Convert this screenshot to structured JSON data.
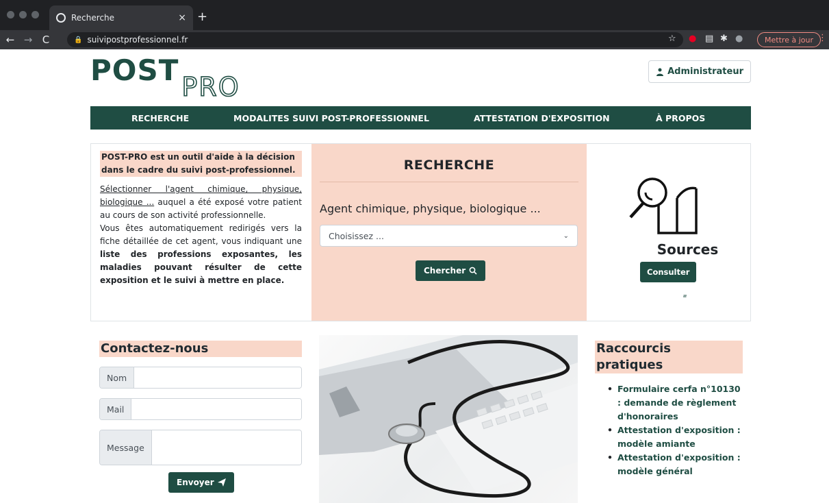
{
  "browser": {
    "tab_title": "Recherche",
    "tab_close": "×",
    "new_tab": "+",
    "url": "suivipostprofessionnel.fr",
    "update_button": "Mettre à jour"
  },
  "header": {
    "logo_post": "POST",
    "logo_pro": "PRO",
    "admin_label": "Administrateur"
  },
  "nav": {
    "items": [
      "RECHERCHE",
      "MODALITES SUIVI POST-PROFESSIONNEL",
      "ATTESTATION D'EXPOSITION",
      "À PROPOS"
    ]
  },
  "intro": {
    "highlight": "POST-PRO est un outil d'aide à la décision dans le cadre du suivi post-professionnel.",
    "select_link": "Sélectionner l'agent chimique, physique, biologique ...",
    "select_rest": " auquel a été exposé votre patient au cours de son activité professionnelle.",
    "redirect_text": "Vous êtes automatiquement redirigés vers la fiche détaillée de cet agent, vous indiquant une ",
    "bold_1": "liste des professions exposantes, les maladies pouvant résulter de cette exposition et le suivi à mettre en place."
  },
  "search": {
    "title": "RECHERCHE",
    "agent_label": "Agent chimique, physique, biologique ...",
    "select_value": "Choisissez ...",
    "button": "Chercher"
  },
  "sources": {
    "title": "Sources",
    "button": "Consulter"
  },
  "contact": {
    "title": "Contactez-nous",
    "name_label": "Nom",
    "mail_label": "Mail",
    "message_label": "Message",
    "send_button": "Envoyer"
  },
  "shortcuts": {
    "title": "Raccourcis pratiques",
    "items": [
      "Formulaire cerfa n°10130 : demande de règlement d'honoraires",
      "Attestation d'exposition : modèle amiante",
      "Attestation d'exposition : modèle général"
    ]
  },
  "colors": {
    "brand_green": "#1f4d43",
    "accent_peach": "#f9d7c9"
  }
}
